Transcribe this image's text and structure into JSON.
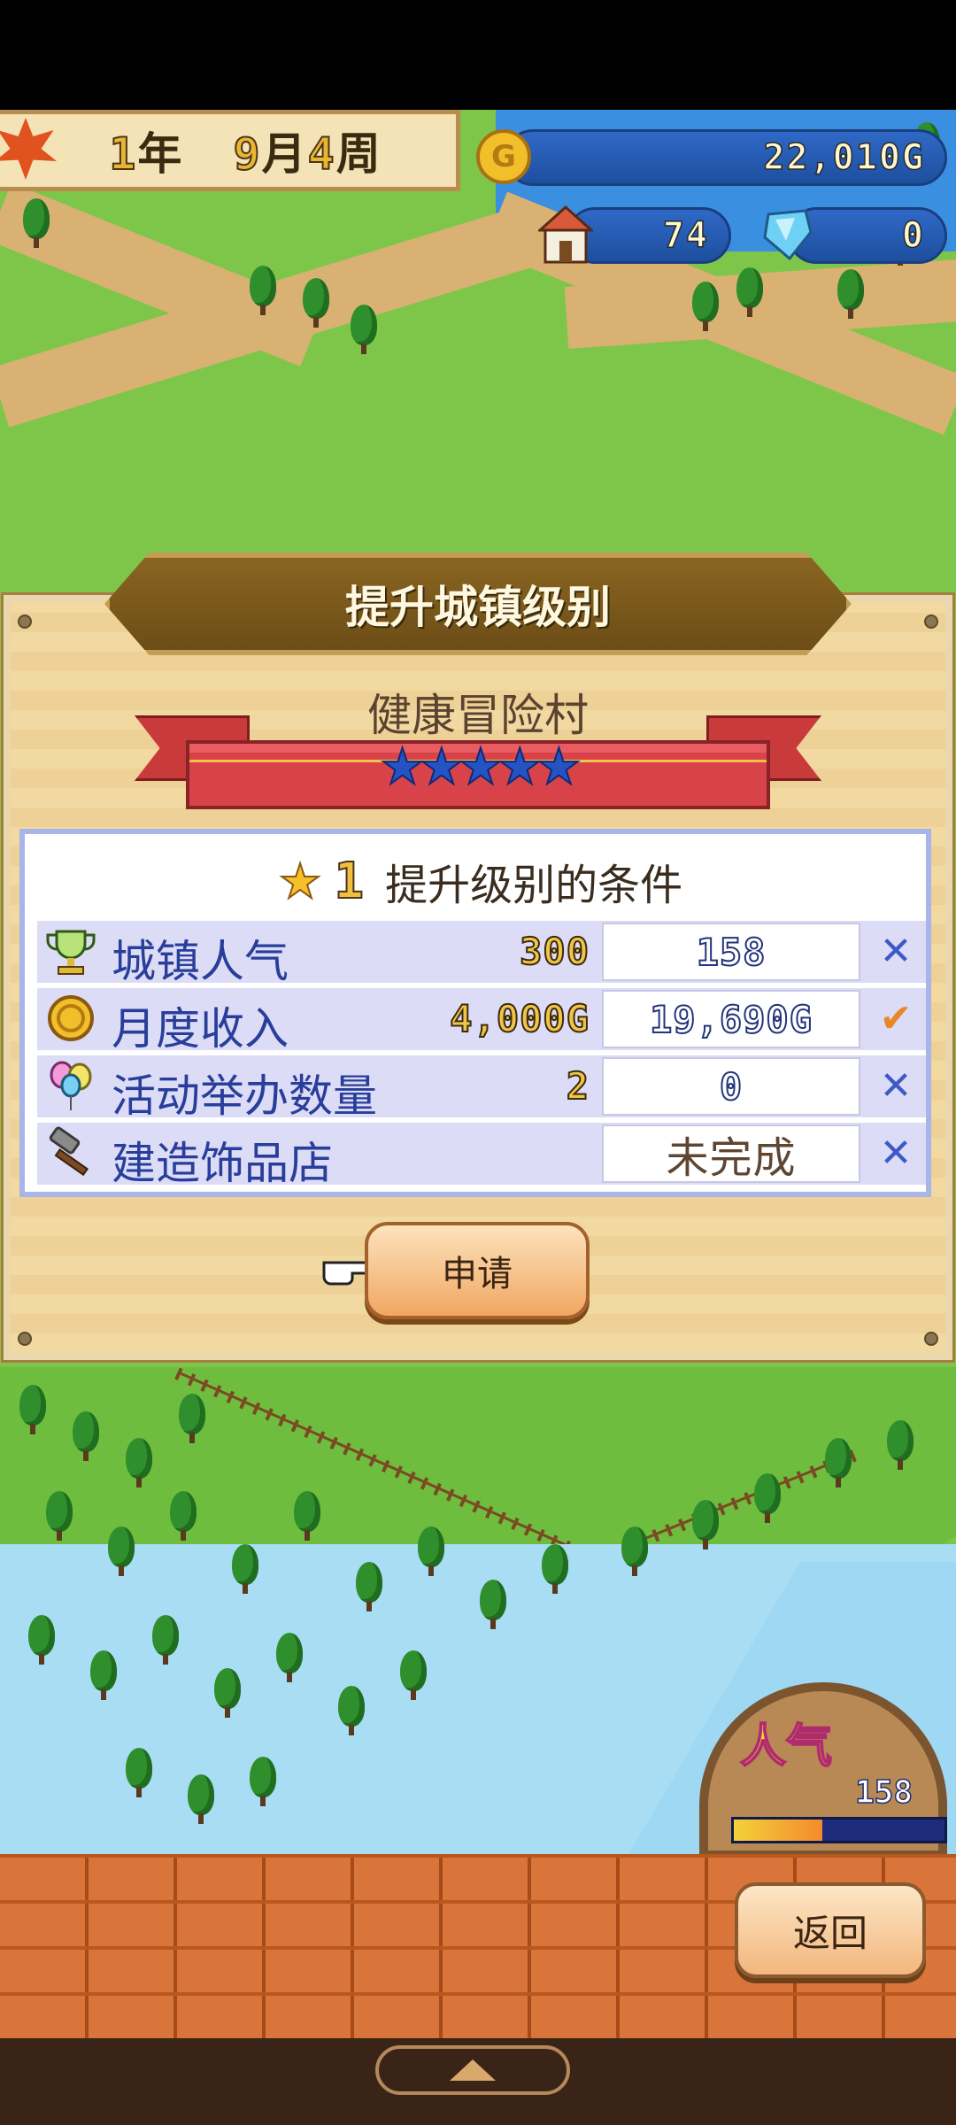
{
  "hud": {
    "date": {
      "year": "1",
      "year_unit": "年",
      "month": "9",
      "month_unit": "月",
      "week": "4",
      "week_unit": "周"
    },
    "gold": "22,010G",
    "houses": "74",
    "crystals": "0"
  },
  "dialog": {
    "title": "提升城镇级别",
    "town_name": "健康冒险村",
    "stars": "★★★★★",
    "conditions_level": "1",
    "conditions_title": "提升级别的条件",
    "rows": [
      {
        "icon": "trophy-icon",
        "label": "城镇人气",
        "required": "300",
        "current": "158",
        "status": "✕"
      },
      {
        "icon": "coin-icon",
        "label": "月度收入",
        "required": "4,000G",
        "current": "19,690G",
        "status": "✔"
      },
      {
        "icon": "balloon-icon",
        "label": "活动举办数量",
        "required": "2",
        "current": "0",
        "status": "✕"
      },
      {
        "icon": "hammer-icon",
        "label": "建造饰品店",
        "required": "",
        "current": "未完成",
        "status": "✕"
      }
    ],
    "apply_label": "申请"
  },
  "popularity": {
    "label": "人气",
    "value": "158",
    "fill_fraction": 0.42
  },
  "bottom": {
    "back_label": "返回"
  },
  "colors": {
    "accent_blue": "#283e9a",
    "unmet": "#3e59c8",
    "met": "#e6872a"
  }
}
